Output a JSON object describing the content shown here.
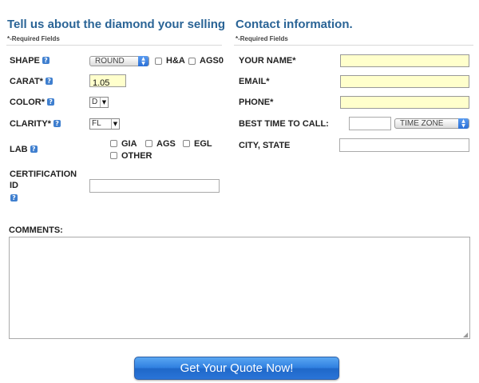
{
  "diamond": {
    "heading": "Tell us about the diamond your selling",
    "required_note": "*-Required Fields",
    "shape": {
      "label": "SHAPE",
      "value": "ROUND",
      "opt_ha": "H&A",
      "opt_ags0": "AGS0"
    },
    "carat": {
      "label": "CARAT*",
      "value": "1.05"
    },
    "color": {
      "label": "COLOR*",
      "value": "D"
    },
    "clarity": {
      "label": "CLARITY*",
      "value": "FL"
    },
    "lab": {
      "label": "LAB",
      "options": [
        "GIA",
        "AGS",
        "EGL",
        "OTHER"
      ]
    },
    "certification": {
      "label_line1": "CERTIFICATION",
      "label_line2": "ID",
      "value": ""
    }
  },
  "contact": {
    "heading": "Contact information.",
    "required_note": "*-Required Fields",
    "name_label": "YOUR NAME*",
    "email_label": "EMAIL*",
    "phone_label": "PHONE*",
    "best_time_label": "BEST TIME TO CALL:",
    "time_zone": "TIME ZONE",
    "city_state_label": "CITY, STATE"
  },
  "comments": {
    "label": "COMMENTS:"
  },
  "submit": {
    "label": "Get Your Quote Now!"
  },
  "colors": {
    "heading": "#2a6496",
    "required_bg": "#ffffcc",
    "button": "#2f7fe0"
  },
  "icons": {
    "help": "?",
    "dropdown": "▲▼"
  }
}
